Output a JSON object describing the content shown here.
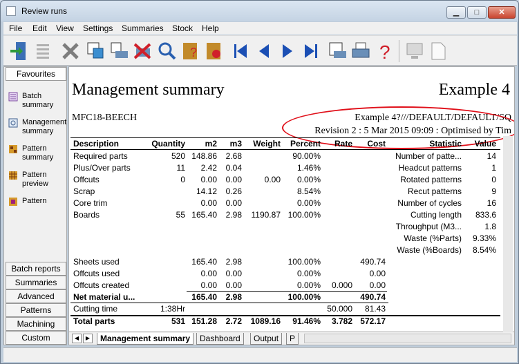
{
  "window": {
    "title": "Review runs"
  },
  "menu": [
    "File",
    "Edit",
    "View",
    "Settings",
    "Summaries",
    "Stock",
    "Help"
  ],
  "sidebar": {
    "favourites_label": "Favourites",
    "items": [
      {
        "label": "Batch summary",
        "icon": "batch-summary-icon"
      },
      {
        "label": "Management summary",
        "icon": "management-summary-icon"
      },
      {
        "label": "Pattern summary",
        "icon": "pattern-summary-icon"
      },
      {
        "label": "Pattern preview",
        "icon": "pattern-preview-icon"
      },
      {
        "label": "Pattern",
        "icon": "pattern-icon"
      }
    ],
    "tabs": [
      "Batch reports",
      "Summaries",
      "Advanced",
      "Patterns",
      "Machining",
      "Custom"
    ]
  },
  "report": {
    "title": "Management summary",
    "example": "Example 4",
    "board": "MFC18-BEECH",
    "path": "Example 4?///DEFAULT/DEFAULT/SQ",
    "revision": "Revision 2 : 5 Mar 2015 09:09 : Optimised by Tim",
    "headers": [
      "Description",
      "Quantity",
      "m2",
      "m3",
      "Weight",
      "Percent",
      "Rate",
      "Cost"
    ],
    "rows": [
      [
        "Required parts",
        "520",
        "148.86",
        "2.68",
        "",
        "90.00%",
        "",
        ""
      ],
      [
        "Plus/Over parts",
        "11",
        "2.42",
        "0.04",
        "",
        "1.46%",
        "",
        ""
      ],
      [
        "Offcuts",
        "0",
        "0.00",
        "0.00",
        "0.00",
        "0.00%",
        "",
        ""
      ],
      [
        "Scrap",
        "",
        "14.12",
        "0.26",
        "",
        "8.54%",
        "",
        ""
      ],
      [
        "Core trim",
        "",
        "0.00",
        "0.00",
        "",
        "0.00%",
        "",
        ""
      ],
      [
        "Boards",
        "55",
        "165.40",
        "2.98",
        "1190.87",
        "100.00%",
        "",
        ""
      ]
    ],
    "rows2": [
      [
        "Sheets used",
        "",
        "165.40",
        "2.98",
        "",
        "100.00%",
        "",
        "490.74"
      ],
      [
        "Offcuts used",
        "",
        "0.00",
        "0.00",
        "",
        "0.00%",
        "",
        "0.00"
      ],
      [
        "Offcuts created",
        "",
        "0.00",
        "0.00",
        "",
        "0.00%",
        "0.000",
        "0.00"
      ]
    ],
    "net_row": [
      "Net material u...",
      "",
      "165.40",
      "2.98",
      "",
      "100.00%",
      "",
      "490.74"
    ],
    "cutting_row": [
      "Cutting time",
      "1:38Hr",
      "",
      "",
      "",
      "",
      "50.000",
      "81.43"
    ],
    "total_row": [
      "Total parts",
      "531",
      "151.28",
      "2.72",
      "1089.16",
      "91.46%",
      "3.782",
      "572.17"
    ],
    "stat_headers": [
      "Statistic",
      "Value"
    ],
    "stats": [
      [
        "Number of patte...",
        "14"
      ],
      [
        "Headcut patterns",
        "1"
      ],
      [
        "Rotated patterns",
        "0"
      ],
      [
        "Recut patterns",
        "9"
      ],
      [
        "Number of cycles",
        "16"
      ],
      [
        "Cutting length",
        "833.6"
      ],
      [
        "Throughput (M3...",
        "1.8"
      ],
      [
        "Waste (%Parts)",
        "9.33%"
      ],
      [
        "Waste (%Boards)",
        "8.54%"
      ]
    ]
  },
  "sheet_tabs": [
    "Management summary",
    "Dashboard",
    "Output",
    "P"
  ],
  "colors": {
    "annotation": "#e0101a",
    "title_bg": "#c4d3e3"
  }
}
